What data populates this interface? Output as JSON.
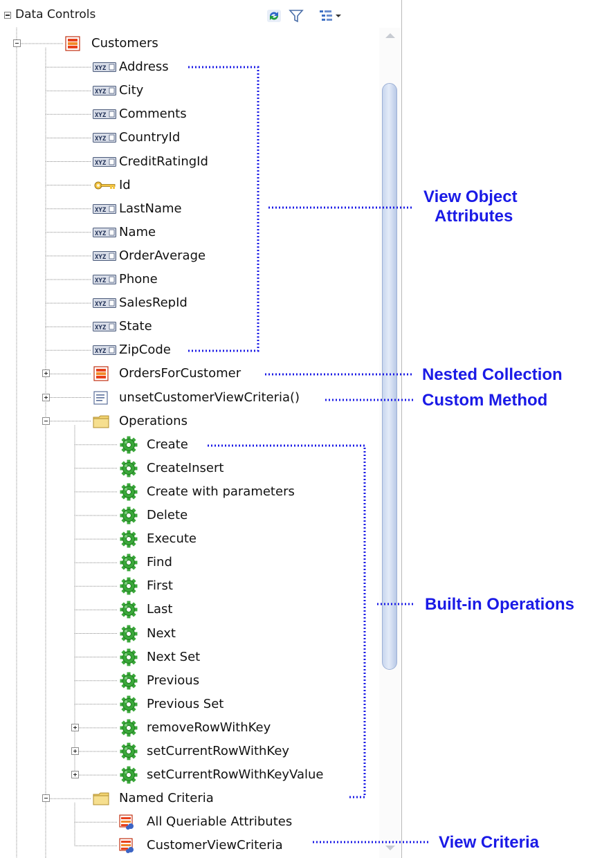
{
  "panel": {
    "title": "Data Controls",
    "toolbar": {
      "refresh_icon": "refresh-icon",
      "filter_icon": "filter-icon",
      "view_options_icon": "view-options-icon"
    }
  },
  "tree": [
    {
      "label": "Customers",
      "level": 1,
      "icon": "collection-icon",
      "expanded": true
    },
    {
      "label": "Address",
      "level": 2,
      "icon": "attribute-icon"
    },
    {
      "label": "City",
      "level": 2,
      "icon": "attribute-icon"
    },
    {
      "label": "Comments",
      "level": 2,
      "icon": "attribute-icon"
    },
    {
      "label": "CountryId",
      "level": 2,
      "icon": "attribute-icon"
    },
    {
      "label": "CreditRatingId",
      "level": 2,
      "icon": "attribute-icon"
    },
    {
      "label": "Id",
      "level": 2,
      "icon": "key-icon"
    },
    {
      "label": "LastName",
      "level": 2,
      "icon": "attribute-icon"
    },
    {
      "label": "Name",
      "level": 2,
      "icon": "attribute-icon"
    },
    {
      "label": "OrderAverage",
      "level": 2,
      "icon": "attribute-icon"
    },
    {
      "label": "Phone",
      "level": 2,
      "icon": "attribute-icon"
    },
    {
      "label": "SalesRepId",
      "level": 2,
      "icon": "attribute-icon"
    },
    {
      "label": "State",
      "level": 2,
      "icon": "attribute-icon"
    },
    {
      "label": "ZipCode",
      "level": 2,
      "icon": "attribute-icon"
    },
    {
      "label": "OrdersForCustomer",
      "level": 2,
      "icon": "collection-icon",
      "expanded": false
    },
    {
      "label": "unsetCustomerViewCriteria()",
      "level": 2,
      "icon": "method-icon",
      "expanded": false
    },
    {
      "label": "Operations",
      "level": 2,
      "icon": "folder-icon",
      "expanded": true
    },
    {
      "label": "Create",
      "level": 3,
      "icon": "operation-gear-icon"
    },
    {
      "label": "CreateInsert",
      "level": 3,
      "icon": "operation-gear-icon"
    },
    {
      "label": "Create with parameters",
      "level": 3,
      "icon": "operation-gear-icon"
    },
    {
      "label": "Delete",
      "level": 3,
      "icon": "operation-gear-icon"
    },
    {
      "label": "Execute",
      "level": 3,
      "icon": "operation-gear-icon"
    },
    {
      "label": "Find",
      "level": 3,
      "icon": "operation-gear-icon"
    },
    {
      "label": "First",
      "level": 3,
      "icon": "operation-gear-icon"
    },
    {
      "label": "Last",
      "level": 3,
      "icon": "operation-gear-icon"
    },
    {
      "label": "Next",
      "level": 3,
      "icon": "operation-gear-icon"
    },
    {
      "label": "Next Set",
      "level": 3,
      "icon": "operation-gear-icon"
    },
    {
      "label": "Previous",
      "level": 3,
      "icon": "operation-gear-icon"
    },
    {
      "label": "Previous Set",
      "level": 3,
      "icon": "operation-gear-icon"
    },
    {
      "label": "removeRowWithKey",
      "level": 3,
      "icon": "operation-gear-icon",
      "expanded": false
    },
    {
      "label": "setCurrentRowWithKey",
      "level": 3,
      "icon": "operation-gear-icon",
      "expanded": false
    },
    {
      "label": "setCurrentRowWithKeyValue",
      "level": 3,
      "icon": "operation-gear-icon",
      "expanded": false
    },
    {
      "label": "Named Criteria",
      "level": 2,
      "icon": "folder-icon",
      "expanded": true
    },
    {
      "label": "All Queriable Attributes",
      "level": 3,
      "icon": "view-criteria-icon"
    },
    {
      "label": "CustomerViewCriteria",
      "level": 3,
      "icon": "view-criteria-icon"
    }
  ],
  "annotations": {
    "view_object_attributes": "View Object\nAttributes",
    "nested_collection": "Nested Collection",
    "custom_method": "Custom Method",
    "built_in_operations": "Built-in Operations",
    "view_criteria": "View Criteria"
  },
  "colors": {
    "annotation": "#1a1ae6",
    "collection_red": "#e8411c",
    "gear_green": "#3aa83a",
    "folder_yellow": "#f2d472",
    "scroll_thumb": "#c8d6ee"
  }
}
